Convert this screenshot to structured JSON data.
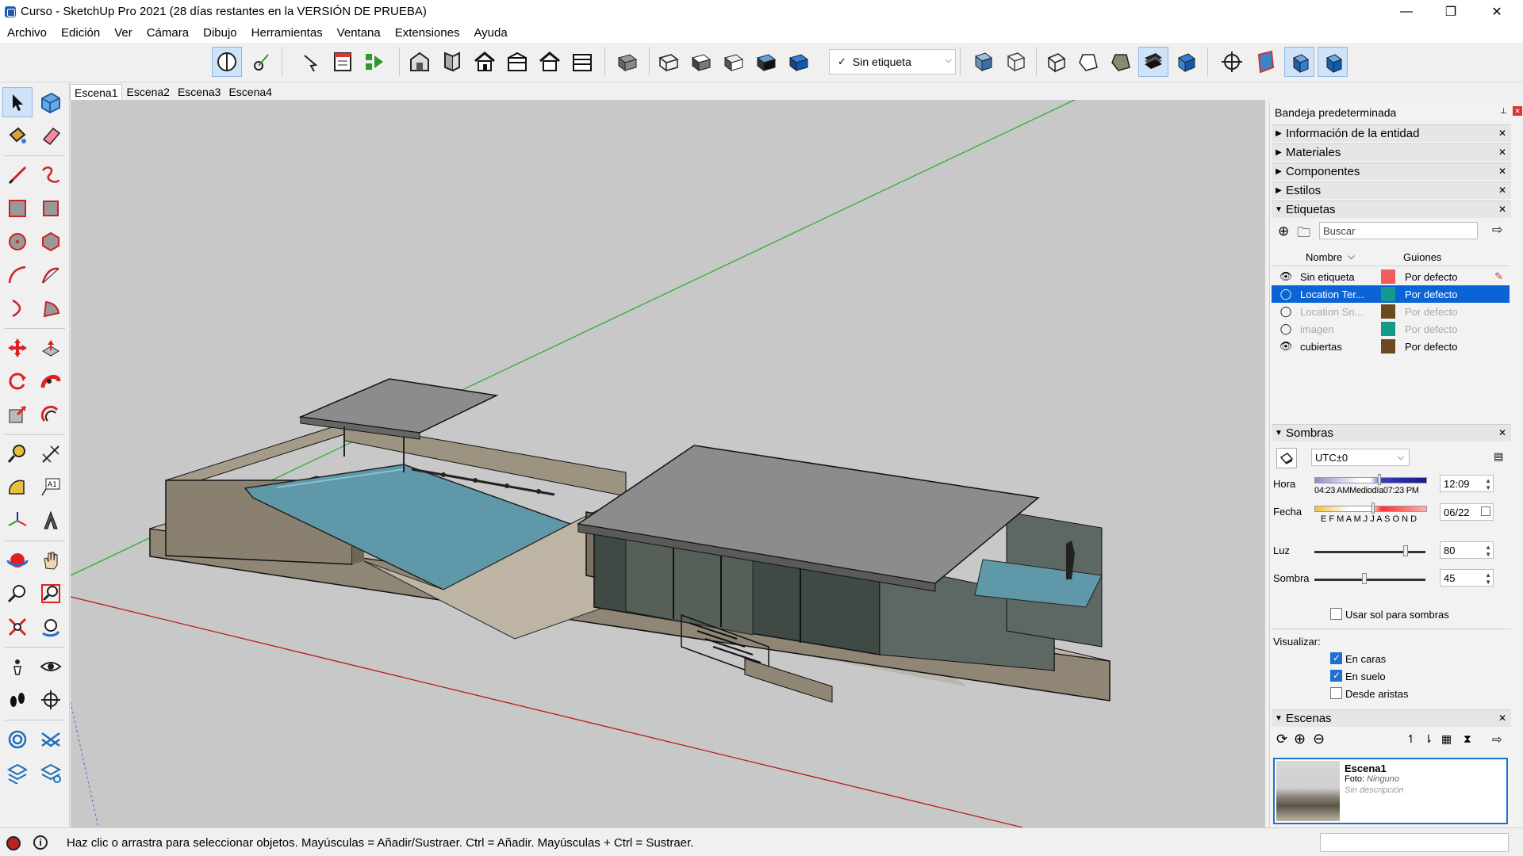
{
  "window": {
    "title": "Curso - SketchUp Pro 2021 (28 días restantes en la VERSIÓN DE PRUEBA)",
    "minimize": "—",
    "maximize": "❐",
    "close": "✕"
  },
  "menu": [
    "Archivo",
    "Edición",
    "Ver",
    "Cámara",
    "Dibujo",
    "Herramientas",
    "Ventana",
    "Extensiones",
    "Ayuda"
  ],
  "toolbar": {
    "tag_select_value": "Sin etiqueta",
    "check": "✓",
    "caret": "⌵"
  },
  "scenes": [
    "Escena1",
    "Escena2",
    "Escena3",
    "Escena4"
  ],
  "tray": {
    "title": "Bandeja predeterminada",
    "pin": "📌",
    "sections": {
      "entity_info": "Información de la entidad",
      "materials": "Materiales",
      "components": "Componentes",
      "styles": "Estilos",
      "tags": "Etiquetas",
      "shadows": "Sombras",
      "scenes": "Escenas"
    },
    "tags": {
      "search_placeholder": "Buscar",
      "col_name": "Nombre",
      "col_dashes": "Guiones",
      "rows": [
        {
          "visible": true,
          "name": "Sin etiqueta",
          "color": "#f25c5c",
          "dashes": "Por defecto",
          "state": "normal"
        },
        {
          "visible": false,
          "name": "Location Ter...",
          "color": "#149a8a",
          "dashes": "Por defecto",
          "state": "selected"
        },
        {
          "visible": false,
          "name": "Location Sn...",
          "color": "#6b4a1f",
          "dashes": "Por defecto",
          "state": "dim"
        },
        {
          "visible": false,
          "name": "imagen",
          "color": "#149a8a",
          "dashes": "Por defecto",
          "state": "dim"
        },
        {
          "visible": true,
          "name": "cubiertas",
          "color": "#6b4a1f",
          "dashes": "Por defecto",
          "state": "normal"
        }
      ]
    },
    "shadows": {
      "timezone": "UTC±0",
      "hora_label": "Hora",
      "hora_ticks": "04:23 AMMediodía07:23 PM",
      "hora_value": "12:09",
      "fecha_label": "Fecha",
      "fecha_ticks": "E F M A M J J A S O N D",
      "fecha_value": "06/22",
      "luz_label": "Luz",
      "luz_value": "80",
      "sombra_label": "Sombra",
      "sombra_value": "45",
      "use_sun": "Usar sol para sombras",
      "visualizar": "Visualizar:",
      "on_faces": "En caras",
      "on_ground": "En suelo",
      "from_edges": "Desde aristas"
    },
    "scene_card": {
      "name": "Escena1",
      "photo_label": "Foto:",
      "photo_value": "Ninguno",
      "description": "Sin descripción"
    }
  },
  "status": {
    "message": "Haz clic o arrastra para seleccionar objetos. Mayúsculas = Añadir/Sustraer. Ctrl = Añadir. Mayúsculas + Ctrl = Sustraer."
  },
  "colors": {
    "axis_green": "#2fae2f",
    "axis_red": "#c01818",
    "selection_blue": "#0a64d6",
    "water": "#5f98a8",
    "concrete": "#9a9282",
    "roof": "#8a8a8a"
  }
}
